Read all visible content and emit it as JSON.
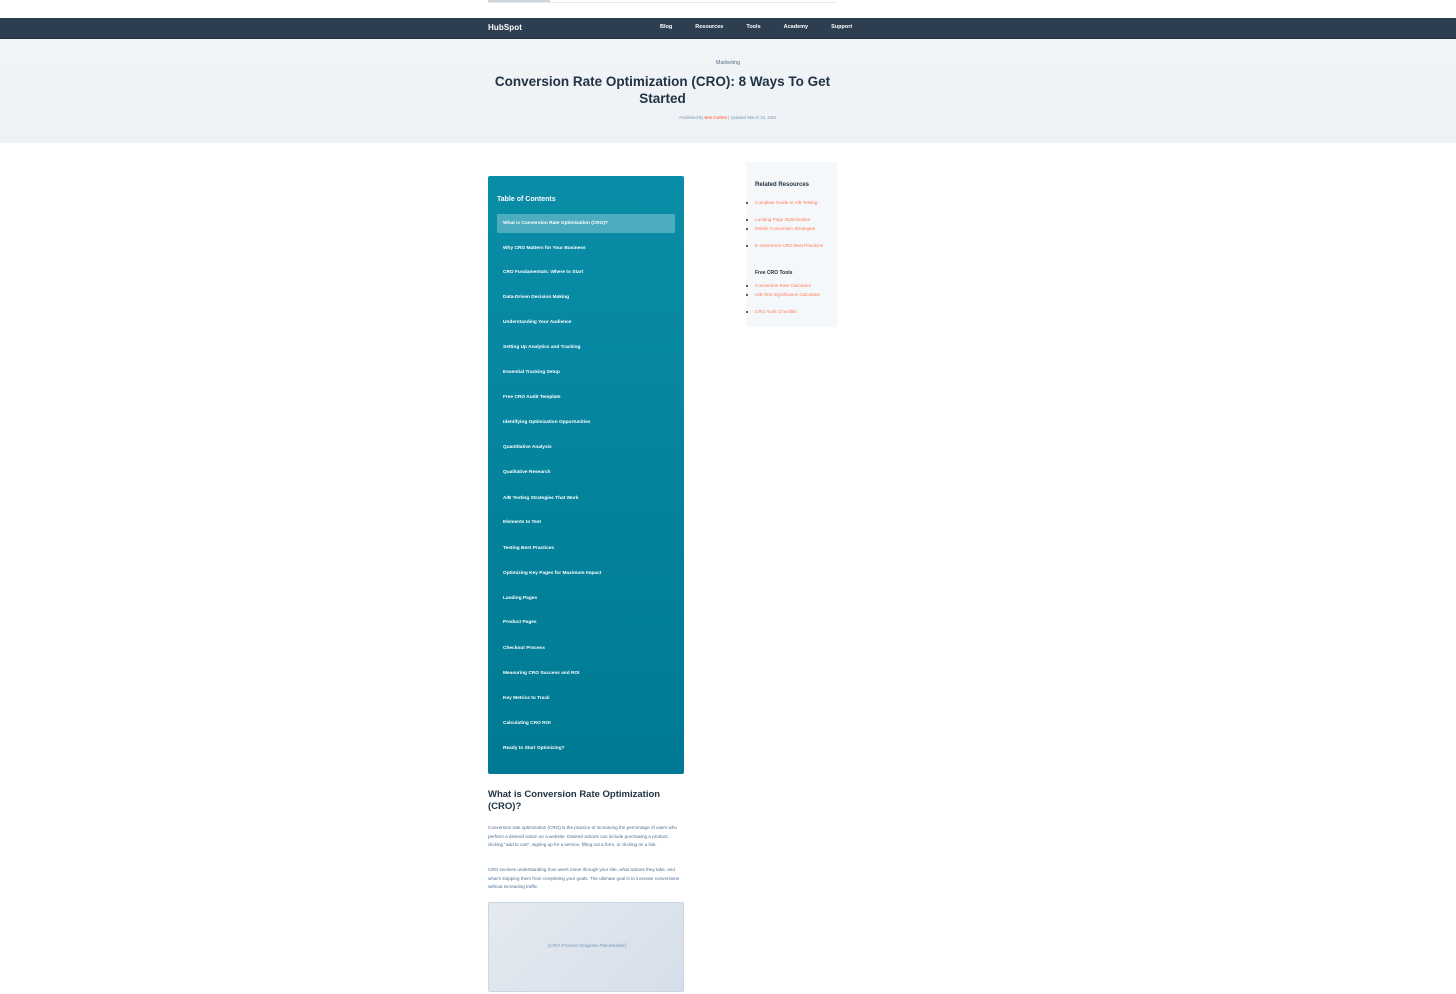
{
  "nav": {
    "logo": "HubSpot",
    "links": [
      "Blog",
      "Resources",
      "Tools",
      "Academy",
      "Support"
    ]
  },
  "hero": {
    "category": "Marketing",
    "title": "Conversion Rate Optimization (CRO): 8 Ways To Get Started",
    "published_prefix": "Published by ",
    "author": "Ben Cotton",
    "updated": " | Updated March 15, 2024"
  },
  "toc": {
    "title": "Table of Contents",
    "items": [
      "What is Conversion Rate Optimization (CRO)?",
      "Why CRO Matters for Your Business",
      "CRO Fundamentals: Where to Start",
      "Data-Driven Decision Making",
      "Understanding Your Audience",
      "Setting Up Analytics and Tracking",
      "Essential Tracking Setup",
      "Free CRO Audit Template",
      "Identifying Optimization Opportunities",
      "Quantitative Analysis",
      "Qualitative Research",
      "A/B Testing Strategies That Work",
      "Elements to Test",
      "Testing Best Practices",
      "Optimizing Key Pages for Maximum Impact",
      "Landing Pages",
      "Product Pages",
      "Checkout Process",
      "Measuring CRO Success and ROI",
      "Key Metrics to Track",
      "Calculating CRO ROI",
      "Ready to Start Optimizing?"
    ]
  },
  "sidebar": {
    "related_title": "Related Resources",
    "related_links": [
      "Complete Guide to A/B Testing",
      "Landing Page Optimization",
      "Mobile Conversion Strategies",
      "E-commerce CRO Best Practices"
    ],
    "tools_title": "Free CRO Tools",
    "tools_links": [
      "Conversion Rate Calculator",
      "A/B Test Significance Calculator",
      "CRO Audit Checklist"
    ]
  },
  "article": {
    "heading": "What is Conversion Rate Optimization (CRO)?",
    "para1": "Conversion rate optimization (CRO) is the practice of increasing the percentage of users who perform a desired action on a website. Desired actions can include purchasing a product, clicking \"add to cart\", signing up for a service, filling out a form, or clicking on a link.",
    "para2": "CRO involves understanding how users move through your site, what actions they take, and what's stopping them from completing your goals. The ultimate goal is to increase conversions without increasing traffic.",
    "diagram_placeholder": "[CRO Process Diagram Placeholder]"
  }
}
